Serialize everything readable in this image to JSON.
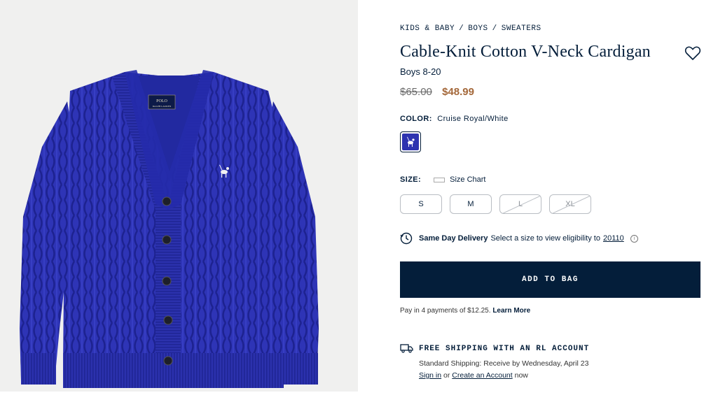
{
  "breadcrumb": [
    "KIDS & BABY",
    "BOYS",
    "SWEATERS"
  ],
  "breadcrumb_sep": "/",
  "product": {
    "title": "Cable-Knit Cotton V-Neck Cardigan",
    "subtitle": "Boys 8-20",
    "price_original": "$65.00",
    "price_sale": "$48.99"
  },
  "color": {
    "label": "COLOR:",
    "value": "Cruise Royal/White",
    "swatch_color": "#2d33b0"
  },
  "size": {
    "label": "SIZE:",
    "chart_label": "Size Chart",
    "options": [
      {
        "label": "S",
        "available": true
      },
      {
        "label": "M",
        "available": true
      },
      {
        "label": "L",
        "available": false
      },
      {
        "label": "XL",
        "available": false
      }
    ]
  },
  "delivery": {
    "title": "Same Day Delivery",
    "text": "Select a size to view eligibility to",
    "zip": "20110"
  },
  "cta": {
    "add_to_bag": "ADD TO BAG"
  },
  "payments": {
    "text": "Pay in 4 payments of $12.25.",
    "link": "Learn More"
  },
  "shipping": {
    "title": "FREE SHIPPING WITH AN RL ACCOUNT",
    "standard": "Standard Shipping: Receive by Wednesday, April 23",
    "sign_in": "Sign in",
    "or": "or",
    "create": "Create an Account",
    "now": "now"
  },
  "colors": {
    "navy": "#041e3a",
    "sale": "#a4683a",
    "sweater": "#2d33b0",
    "left_bg": "#f0f0ef"
  },
  "image_text": {
    "logo_line1": "POLO",
    "logo_line2": "RALPH LAUREN"
  }
}
